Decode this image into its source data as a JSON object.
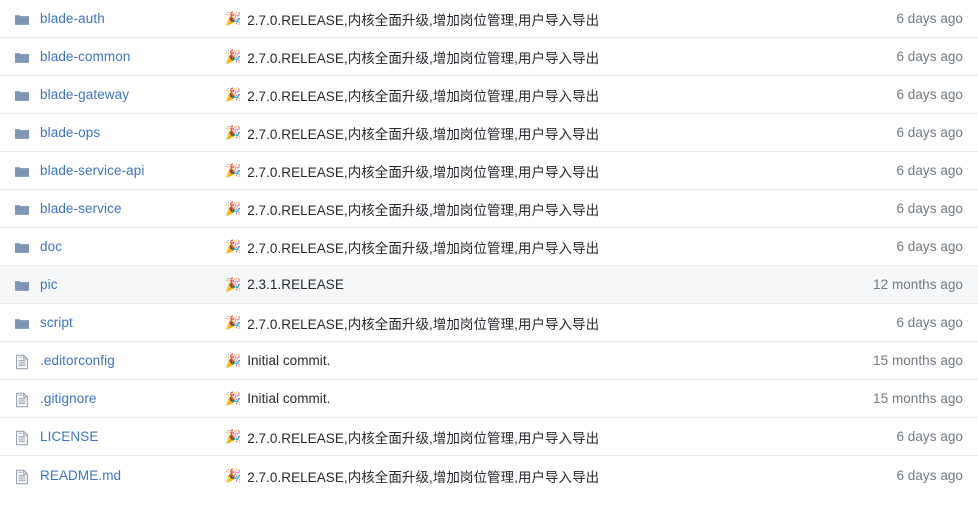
{
  "repo_listing": {
    "icons": {
      "folder": "folder-icon",
      "file": "file-icon",
      "commit_emoji": "party-popper-icon"
    },
    "colors": {
      "link": "#3d73c4",
      "text": "#24292e",
      "muted": "#707a82",
      "border": "#eaecef",
      "row_highlight": "#f6f7f9",
      "folder_icon": "#7e96b3",
      "file_icon": "#8a99a8"
    },
    "commit_emoji": "🎉",
    "rows": [
      {
        "name": "blade-auth",
        "type": "folder",
        "message": "2.7.0.RELEASE,内核全面升级,增加岗位管理,用户导入导出",
        "time": "6 days ago",
        "highlight": false
      },
      {
        "name": "blade-common",
        "type": "folder",
        "message": "2.7.0.RELEASE,内核全面升级,增加岗位管理,用户导入导出",
        "time": "6 days ago",
        "highlight": false
      },
      {
        "name": "blade-gateway",
        "type": "folder",
        "message": "2.7.0.RELEASE,内核全面升级,增加岗位管理,用户导入导出",
        "time": "6 days ago",
        "highlight": false
      },
      {
        "name": "blade-ops",
        "type": "folder",
        "message": "2.7.0.RELEASE,内核全面升级,增加岗位管理,用户导入导出",
        "time": "6 days ago",
        "highlight": false
      },
      {
        "name": "blade-service-api",
        "type": "folder",
        "message": "2.7.0.RELEASE,内核全面升级,增加岗位管理,用户导入导出",
        "time": "6 days ago",
        "highlight": false
      },
      {
        "name": "blade-service",
        "type": "folder",
        "message": "2.7.0.RELEASE,内核全面升级,增加岗位管理,用户导入导出",
        "time": "6 days ago",
        "highlight": false
      },
      {
        "name": "doc",
        "type": "folder",
        "message": "2.7.0.RELEASE,内核全面升级,增加岗位管理,用户导入导出",
        "time": "6 days ago",
        "highlight": false
      },
      {
        "name": "pic",
        "type": "folder",
        "message": "2.3.1.RELEASE",
        "time": "12 months ago",
        "highlight": true
      },
      {
        "name": "script",
        "type": "folder",
        "message": "2.7.0.RELEASE,内核全面升级,增加岗位管理,用户导入导出",
        "time": "6 days ago",
        "highlight": false
      },
      {
        "name": ".editorconfig",
        "type": "file",
        "message": "Initial commit.",
        "time": "15 months ago",
        "highlight": false
      },
      {
        "name": ".gitignore",
        "type": "file",
        "message": "Initial commit.",
        "time": "15 months ago",
        "highlight": false
      },
      {
        "name": "LICENSE",
        "type": "file",
        "message": "2.7.0.RELEASE,内核全面升级,增加岗位管理,用户导入导出",
        "time": "6 days ago",
        "highlight": false
      },
      {
        "name": "README.md",
        "type": "file",
        "message": "2.7.0.RELEASE,内核全面升级,增加岗位管理,用户导入导出",
        "time": "6 days ago",
        "highlight": false
      }
    ]
  }
}
